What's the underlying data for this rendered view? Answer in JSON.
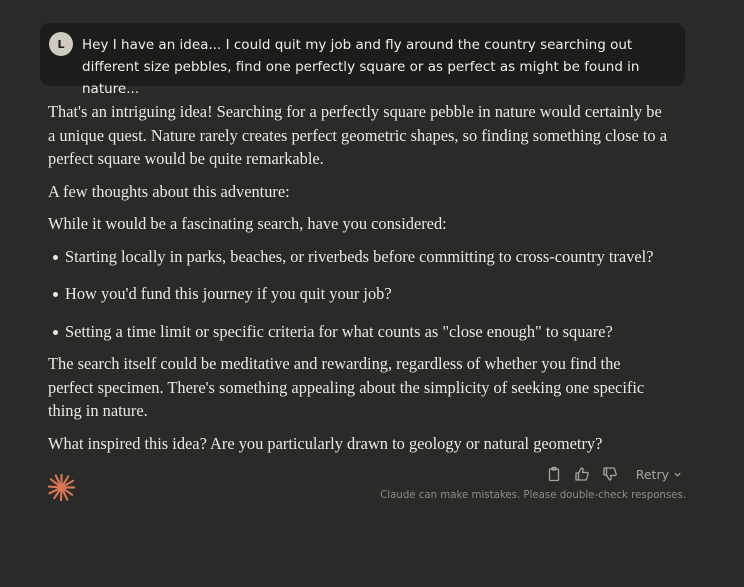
{
  "user_message": {
    "avatar_initial": "L",
    "text": "Hey I have an idea... I could quit my job and fly around the country searching out different size pebbles, find one perfectly square or as perfect as might be found in nature..."
  },
  "response": {
    "paragraph_1": "That's an intriguing idea! Searching for a perfectly square pebble in nature would certainly be a unique quest. Nature rarely creates perfect geometric shapes, so finding something close to a perfect square would be quite remarkable.",
    "paragraph_2": "A few thoughts about this adventure:",
    "paragraph_3": "While it would be a fascinating search, have you considered:",
    "bullets": [
      "Starting locally in parks, beaches, or riverbeds before committing to cross-country travel?",
      "How you'd fund this journey if you quit your job?",
      "Setting a time limit or specific criteria for what counts as \"close enough\" to square?"
    ],
    "paragraph_4": "The search itself could be meditative and rewarding, regardless of whether you find the perfect specimen. There's something appealing about the simplicity of seeking one specific thing in nature.",
    "paragraph_5": "What inspired this idea? Are you particularly drawn to geology or natural geometry?"
  },
  "actions": {
    "copy_icon": "clipboard-icon",
    "thumbs_up_icon": "thumbs-up-icon",
    "thumbs_down_icon": "thumbs-down-icon",
    "retry_label": "Retry"
  },
  "disclaimer": "Claude can make mistakes. Please double-check responses.",
  "colors": {
    "background": "#2a2a28",
    "user_bubble": "#1c1c1a",
    "logo_accent": "#d97757"
  }
}
